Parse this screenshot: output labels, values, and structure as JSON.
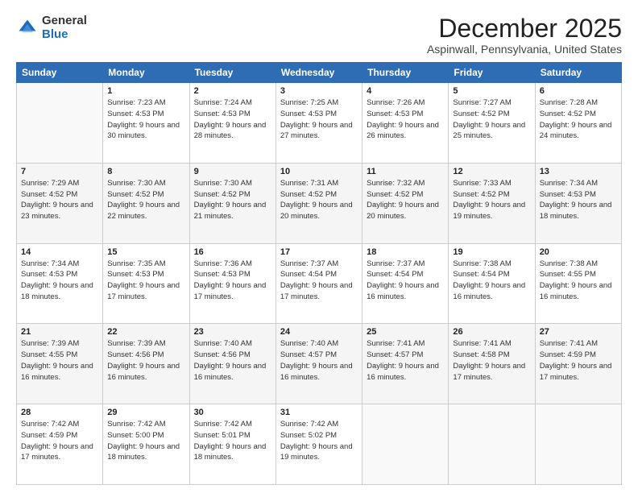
{
  "logo": {
    "general": "General",
    "blue": "Blue"
  },
  "header": {
    "month": "December 2025",
    "location": "Aspinwall, Pennsylvania, United States"
  },
  "weekdays": [
    "Sunday",
    "Monday",
    "Tuesday",
    "Wednesday",
    "Thursday",
    "Friday",
    "Saturday"
  ],
  "weeks": [
    [
      {
        "day": "",
        "sunrise": "",
        "sunset": "",
        "daylight": "",
        "empty": true
      },
      {
        "day": "1",
        "sunrise": "Sunrise: 7:23 AM",
        "sunset": "Sunset: 4:53 PM",
        "daylight": "Daylight: 9 hours and 30 minutes.",
        "empty": false
      },
      {
        "day": "2",
        "sunrise": "Sunrise: 7:24 AM",
        "sunset": "Sunset: 4:53 PM",
        "daylight": "Daylight: 9 hours and 28 minutes.",
        "empty": false
      },
      {
        "day": "3",
        "sunrise": "Sunrise: 7:25 AM",
        "sunset": "Sunset: 4:53 PM",
        "daylight": "Daylight: 9 hours and 27 minutes.",
        "empty": false
      },
      {
        "day": "4",
        "sunrise": "Sunrise: 7:26 AM",
        "sunset": "Sunset: 4:53 PM",
        "daylight": "Daylight: 9 hours and 26 minutes.",
        "empty": false
      },
      {
        "day": "5",
        "sunrise": "Sunrise: 7:27 AM",
        "sunset": "Sunset: 4:52 PM",
        "daylight": "Daylight: 9 hours and 25 minutes.",
        "empty": false
      },
      {
        "day": "6",
        "sunrise": "Sunrise: 7:28 AM",
        "sunset": "Sunset: 4:52 PM",
        "daylight": "Daylight: 9 hours and 24 minutes.",
        "empty": false
      }
    ],
    [
      {
        "day": "7",
        "sunrise": "Sunrise: 7:29 AM",
        "sunset": "Sunset: 4:52 PM",
        "daylight": "Daylight: 9 hours and 23 minutes.",
        "empty": false
      },
      {
        "day": "8",
        "sunrise": "Sunrise: 7:30 AM",
        "sunset": "Sunset: 4:52 PM",
        "daylight": "Daylight: 9 hours and 22 minutes.",
        "empty": false
      },
      {
        "day": "9",
        "sunrise": "Sunrise: 7:30 AM",
        "sunset": "Sunset: 4:52 PM",
        "daylight": "Daylight: 9 hours and 21 minutes.",
        "empty": false
      },
      {
        "day": "10",
        "sunrise": "Sunrise: 7:31 AM",
        "sunset": "Sunset: 4:52 PM",
        "daylight": "Daylight: 9 hours and 20 minutes.",
        "empty": false
      },
      {
        "day": "11",
        "sunrise": "Sunrise: 7:32 AM",
        "sunset": "Sunset: 4:52 PM",
        "daylight": "Daylight: 9 hours and 20 minutes.",
        "empty": false
      },
      {
        "day": "12",
        "sunrise": "Sunrise: 7:33 AM",
        "sunset": "Sunset: 4:52 PM",
        "daylight": "Daylight: 9 hours and 19 minutes.",
        "empty": false
      },
      {
        "day": "13",
        "sunrise": "Sunrise: 7:34 AM",
        "sunset": "Sunset: 4:53 PM",
        "daylight": "Daylight: 9 hours and 18 minutes.",
        "empty": false
      }
    ],
    [
      {
        "day": "14",
        "sunrise": "Sunrise: 7:34 AM",
        "sunset": "Sunset: 4:53 PM",
        "daylight": "Daylight: 9 hours and 18 minutes.",
        "empty": false
      },
      {
        "day": "15",
        "sunrise": "Sunrise: 7:35 AM",
        "sunset": "Sunset: 4:53 PM",
        "daylight": "Daylight: 9 hours and 17 minutes.",
        "empty": false
      },
      {
        "day": "16",
        "sunrise": "Sunrise: 7:36 AM",
        "sunset": "Sunset: 4:53 PM",
        "daylight": "Daylight: 9 hours and 17 minutes.",
        "empty": false
      },
      {
        "day": "17",
        "sunrise": "Sunrise: 7:37 AM",
        "sunset": "Sunset: 4:54 PM",
        "daylight": "Daylight: 9 hours and 17 minutes.",
        "empty": false
      },
      {
        "day": "18",
        "sunrise": "Sunrise: 7:37 AM",
        "sunset": "Sunset: 4:54 PM",
        "daylight": "Daylight: 9 hours and 16 minutes.",
        "empty": false
      },
      {
        "day": "19",
        "sunrise": "Sunrise: 7:38 AM",
        "sunset": "Sunset: 4:54 PM",
        "daylight": "Daylight: 9 hours and 16 minutes.",
        "empty": false
      },
      {
        "day": "20",
        "sunrise": "Sunrise: 7:38 AM",
        "sunset": "Sunset: 4:55 PM",
        "daylight": "Daylight: 9 hours and 16 minutes.",
        "empty": false
      }
    ],
    [
      {
        "day": "21",
        "sunrise": "Sunrise: 7:39 AM",
        "sunset": "Sunset: 4:55 PM",
        "daylight": "Daylight: 9 hours and 16 minutes.",
        "empty": false
      },
      {
        "day": "22",
        "sunrise": "Sunrise: 7:39 AM",
        "sunset": "Sunset: 4:56 PM",
        "daylight": "Daylight: 9 hours and 16 minutes.",
        "empty": false
      },
      {
        "day": "23",
        "sunrise": "Sunrise: 7:40 AM",
        "sunset": "Sunset: 4:56 PM",
        "daylight": "Daylight: 9 hours and 16 minutes.",
        "empty": false
      },
      {
        "day": "24",
        "sunrise": "Sunrise: 7:40 AM",
        "sunset": "Sunset: 4:57 PM",
        "daylight": "Daylight: 9 hours and 16 minutes.",
        "empty": false
      },
      {
        "day": "25",
        "sunrise": "Sunrise: 7:41 AM",
        "sunset": "Sunset: 4:57 PM",
        "daylight": "Daylight: 9 hours and 16 minutes.",
        "empty": false
      },
      {
        "day": "26",
        "sunrise": "Sunrise: 7:41 AM",
        "sunset": "Sunset: 4:58 PM",
        "daylight": "Daylight: 9 hours and 17 minutes.",
        "empty": false
      },
      {
        "day": "27",
        "sunrise": "Sunrise: 7:41 AM",
        "sunset": "Sunset: 4:59 PM",
        "daylight": "Daylight: 9 hours and 17 minutes.",
        "empty": false
      }
    ],
    [
      {
        "day": "28",
        "sunrise": "Sunrise: 7:42 AM",
        "sunset": "Sunset: 4:59 PM",
        "daylight": "Daylight: 9 hours and 17 minutes.",
        "empty": false
      },
      {
        "day": "29",
        "sunrise": "Sunrise: 7:42 AM",
        "sunset": "Sunset: 5:00 PM",
        "daylight": "Daylight: 9 hours and 18 minutes.",
        "empty": false
      },
      {
        "day": "30",
        "sunrise": "Sunrise: 7:42 AM",
        "sunset": "Sunset: 5:01 PM",
        "daylight": "Daylight: 9 hours and 18 minutes.",
        "empty": false
      },
      {
        "day": "31",
        "sunrise": "Sunrise: 7:42 AM",
        "sunset": "Sunset: 5:02 PM",
        "daylight": "Daylight: 9 hours and 19 minutes.",
        "empty": false
      },
      {
        "day": "",
        "sunrise": "",
        "sunset": "",
        "daylight": "",
        "empty": true
      },
      {
        "day": "",
        "sunrise": "",
        "sunset": "",
        "daylight": "",
        "empty": true
      },
      {
        "day": "",
        "sunrise": "",
        "sunset": "",
        "daylight": "",
        "empty": true
      }
    ]
  ]
}
